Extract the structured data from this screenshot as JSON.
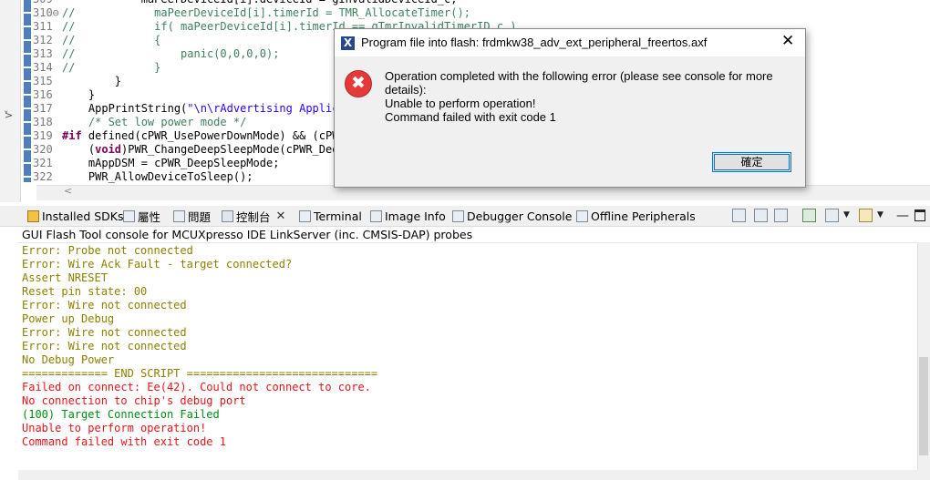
{
  "editor": {
    "lines": [
      {
        "num": "309",
        "segments": [
          {
            "t": "            maPeerDeviceId[i].deviceId = gInvalidDeviceId_c;",
            "c": "plain"
          }
        ]
      },
      {
        "num": "310⊖",
        "segments": [
          {
            "t": "//",
            "c": "comment"
          },
          {
            "t": "            maPeerDeviceId[i].timerId = TMR_AllocateTimer();",
            "c": "comment"
          }
        ]
      },
      {
        "num": "311",
        "segments": [
          {
            "t": "//",
            "c": "comment"
          },
          {
            "t": "            if( maPeerDeviceId[i].timerId == gTmrInvalidTimerID_c )",
            "c": "comment"
          }
        ]
      },
      {
        "num": "312",
        "segments": [
          {
            "t": "//",
            "c": "comment"
          },
          {
            "t": "            {",
            "c": "comment"
          }
        ]
      },
      {
        "num": "313",
        "segments": [
          {
            "t": "//",
            "c": "comment"
          },
          {
            "t": "                panic(0,0,0,0);",
            "c": "comment"
          }
        ]
      },
      {
        "num": "314",
        "segments": [
          {
            "t": "//",
            "c": "comment"
          },
          {
            "t": "            }",
            "c": "comment"
          }
        ]
      },
      {
        "num": "315",
        "segments": [
          {
            "t": "        }",
            "c": "plain"
          }
        ]
      },
      {
        "num": "316",
        "segments": [
          {
            "t": "    }",
            "c": "plain"
          }
        ]
      },
      {
        "num": "317",
        "segments": [
          {
            "t": "    AppPrintString(",
            "c": "plain"
          },
          {
            "t": "\"\\n\\rAdvertising Applica",
            "c": "str"
          }
        ]
      },
      {
        "num": "318",
        "segments": [
          {
            "t": "    ",
            "c": "plain"
          },
          {
            "t": "/* Set low power mode */",
            "c": "comment"
          }
        ]
      },
      {
        "num": "319",
        "segments": [
          {
            "t": "#if",
            "c": "kw"
          },
          {
            "t": " defined(cPWR_UsePowerDownMode) && (cPWR",
            "c": "plain"
          }
        ]
      },
      {
        "num": "320",
        "segments": [
          {
            "t": "    (",
            "c": "plain"
          },
          {
            "t": "void",
            "c": "kw"
          },
          {
            "t": ")PWR_ChangeDeepSleepMode(cPWR_Deep",
            "c": "plain"
          }
        ]
      },
      {
        "num": "321",
        "segments": [
          {
            "t": "    mAppDSM = cPWR_DeepSleepMode;",
            "c": "plain"
          }
        ]
      },
      {
        "num": "322",
        "segments": [
          {
            "t": "    PWR_AllowDeviceToSleep();",
            "c": "plain"
          }
        ]
      }
    ]
  },
  "views": {
    "tabs": [
      {
        "label": "Installed SDKs",
        "name": "tab-installed-sdks"
      },
      {
        "label": "屬性",
        "name": "tab-properties"
      },
      {
        "label": "問題",
        "name": "tab-problems"
      },
      {
        "label": "控制台",
        "name": "tab-console"
      },
      {
        "label": "Terminal",
        "name": "tab-terminal"
      },
      {
        "label": "Image Info",
        "name": "tab-image-info"
      },
      {
        "label": "Debugger Console",
        "name": "tab-debugger-console"
      },
      {
        "label": "Offline Peripherals",
        "name": "tab-offline-peripherals"
      }
    ],
    "active_tab_close": "✕"
  },
  "console": {
    "title": "GUI Flash Tool console for MCUXpresso IDE LinkServer (inc. CMSIS-DAP) probes",
    "lines": [
      {
        "text": "Error: Probe not connected",
        "color": "olive"
      },
      {
        "text": "Error: Wire Ack Fault - target connected?",
        "color": "olive"
      },
      {
        "text": "Assert NRESET",
        "color": "olive"
      },
      {
        "text": "Reset pin state: 00",
        "color": "olive"
      },
      {
        "text": "Error: Wire not connected",
        "color": "olive"
      },
      {
        "text": "Power up Debug",
        "color": "olive"
      },
      {
        "text": "Error: Wire not connected",
        "color": "olive"
      },
      {
        "text": "Error: Wire not connected",
        "color": "olive"
      },
      {
        "text": "No Debug Power",
        "color": "olive"
      },
      {
        "text": "============= END SCRIPT =============================",
        "color": "olive"
      },
      {
        "text": "Failed on connect: Ee(42). Could not connect to core.",
        "color": "red"
      },
      {
        "text": "No connection to chip's debug port",
        "color": "red"
      },
      {
        "text": "(100) Target Connection Failed",
        "color": "green"
      },
      {
        "text": "Unable to perform operation!",
        "color": "red"
      },
      {
        "text": "Command failed with exit code 1",
        "color": "red"
      }
    ]
  },
  "dialog": {
    "title": "Program file into flash: frdmkw38_adv_ext_peripheral_freertos.axf",
    "close_glyph": "✕",
    "error_glyph": "✖",
    "app_glyph": "X",
    "message_lines": [
      "Operation completed with the following error (please see console for more details):",
      "Unable to perform operation!",
      "Command failed with exit code 1"
    ],
    "ok_label": "確定"
  },
  "colors": {
    "error_red": "#e5393a",
    "console_olive": "#8b8000",
    "console_red": "#e8141a",
    "console_green": "#008c13",
    "accent_blue": "#0078d7"
  }
}
